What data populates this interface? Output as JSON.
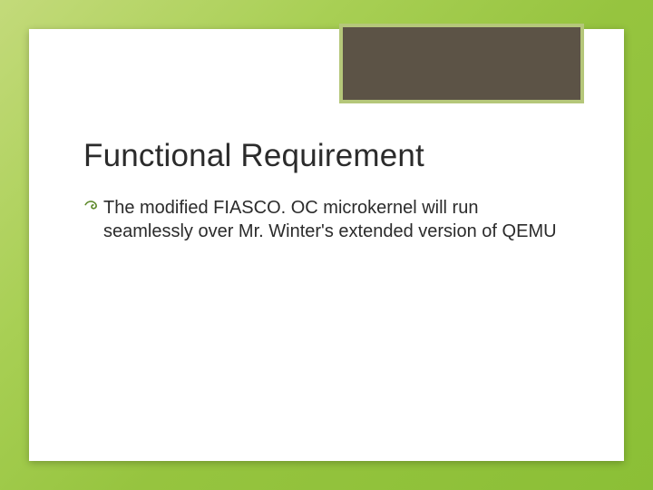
{
  "slide": {
    "title": "Functional Requirement",
    "bullets": [
      {
        "text": "The modified FIASCO. OC microkernel will run seamlessly over Mr. Winter's extended version of QEMU"
      }
    ]
  }
}
